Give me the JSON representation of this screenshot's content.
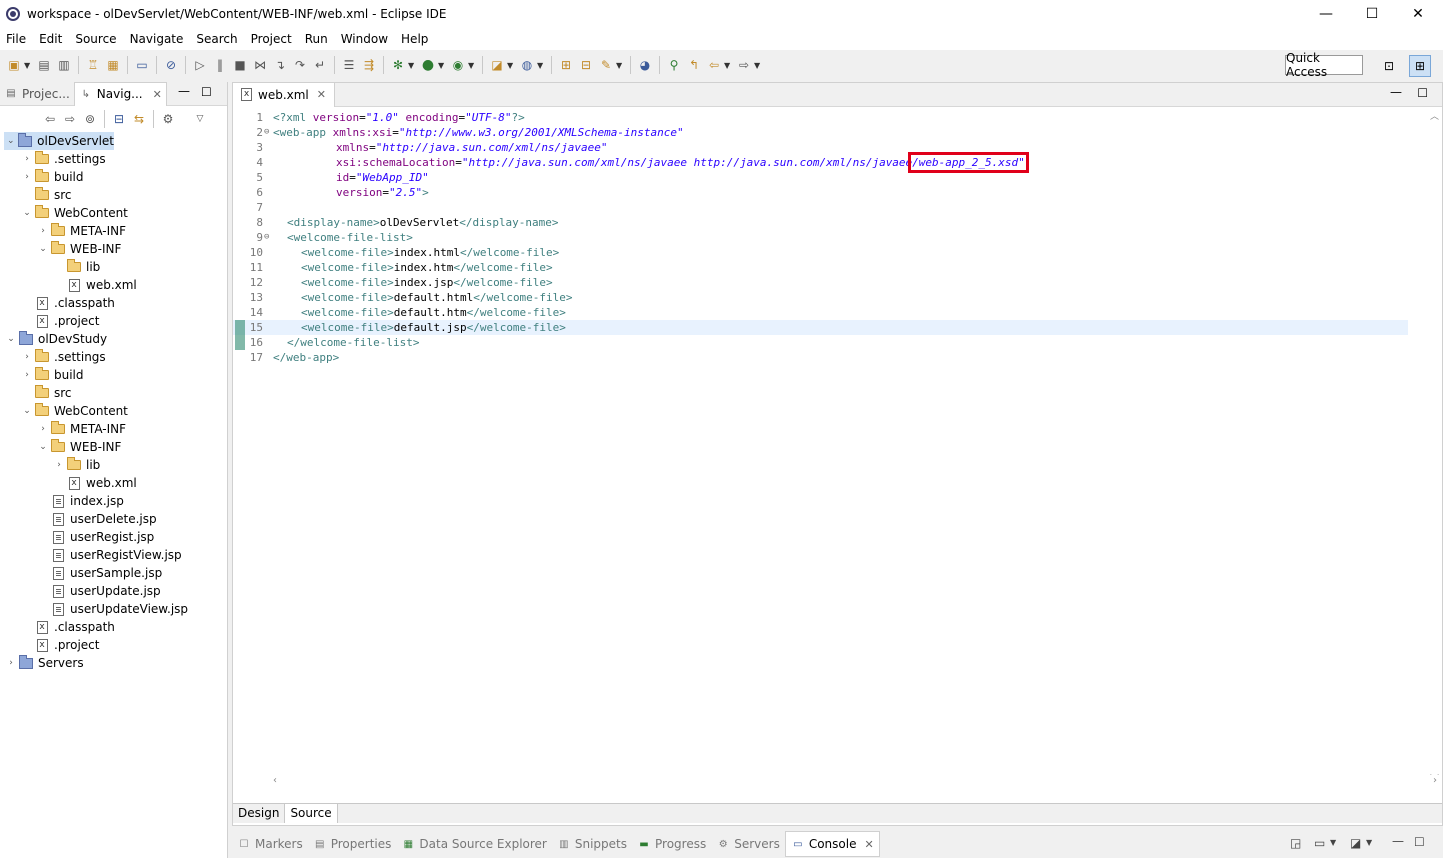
{
  "window": {
    "title": "workspace - olDevServlet/WebContent/WEB-INF/web.xml - Eclipse IDE",
    "minimize": "—",
    "maximize": "☐",
    "close": "✕"
  },
  "menu": [
    "File",
    "Edit",
    "Source",
    "Navigate",
    "Search",
    "Project",
    "Run",
    "Window",
    "Help"
  ],
  "toolbar": {
    "quick_access": "Quick Access"
  },
  "left_panel": {
    "tabs": [
      {
        "label": "Projec..."
      },
      {
        "label": "Navig..."
      }
    ],
    "tree": [
      {
        "label": "olDevServlet",
        "icon": "project-icon",
        "expanded": true,
        "selected": true
      },
      {
        "label": ".settings",
        "icon": "folder-icon"
      },
      {
        "label": "build",
        "icon": "folder-icon"
      },
      {
        "label": "src",
        "icon": "folder-icon"
      },
      {
        "label": "WebContent",
        "icon": "folder-icon"
      },
      {
        "label": "META-INF",
        "icon": "folder-icon"
      },
      {
        "label": "WEB-INF",
        "icon": "folder-icon"
      },
      {
        "label": "lib",
        "icon": "folder-icon"
      },
      {
        "label": "web.xml",
        "icon": "xml-file-icon"
      },
      {
        "label": ".classpath",
        "icon": "xml-file-icon"
      },
      {
        "label": ".project",
        "icon": "xml-file-icon"
      },
      {
        "label": "olDevStudy",
        "icon": "project-icon"
      },
      {
        "label": ".settings",
        "icon": "folder-icon"
      },
      {
        "label": "build",
        "icon": "folder-icon"
      },
      {
        "label": "src",
        "icon": "folder-icon"
      },
      {
        "label": "WebContent",
        "icon": "folder-icon"
      },
      {
        "label": "META-INF",
        "icon": "folder-icon"
      },
      {
        "label": "WEB-INF",
        "icon": "folder-icon"
      },
      {
        "label": "lib",
        "icon": "folder-icon"
      },
      {
        "label": "web.xml",
        "icon": "xml-file-icon"
      },
      {
        "label": "index.jsp",
        "icon": "jsp-file-icon"
      },
      {
        "label": "userDelete.jsp",
        "icon": "jsp-file-icon"
      },
      {
        "label": "userRegist.jsp",
        "icon": "jsp-file-icon"
      },
      {
        "label": "userRegistView.jsp",
        "icon": "jsp-file-icon"
      },
      {
        "label": "userSample.jsp",
        "icon": "jsp-file-icon"
      },
      {
        "label": "userUpdate.jsp",
        "icon": "jsp-file-icon"
      },
      {
        "label": "userUpdateView.jsp",
        "icon": "jsp-file-icon"
      },
      {
        "label": ".classpath",
        "icon": "xml-file-icon"
      },
      {
        "label": ".project",
        "icon": "xml-file-icon"
      },
      {
        "label": "Servers",
        "icon": "project-icon"
      }
    ]
  },
  "editor": {
    "tab_label": "web.xml",
    "lines": [
      "1",
      "2",
      "3",
      "4",
      "5",
      "6",
      "7",
      "8",
      "9",
      "10",
      "11",
      "12",
      "13",
      "14",
      "15",
      "16",
      "17"
    ],
    "code": {
      "l1": [
        "<?xml ",
        "version",
        "=",
        "\"1.0\"",
        " ",
        "encoding",
        "=",
        "\"UTF-8\"",
        "?>"
      ],
      "l2": [
        "<web-app ",
        "xmlns:xsi",
        "=",
        "\"http://www.w3.org/2001/XMLSchema-instance\""
      ],
      "l3": [
        "xmlns",
        "=",
        "\"http://java.sun.com/xml/ns/javaee\""
      ],
      "l4": [
        "xsi:schemaLocation",
        "=",
        "\"http://java.sun.com/xml/ns/javaee http://java.sun.com/xml/ns/javaee",
        "/web-app_2_5.xsd\""
      ],
      "l5": [
        "id",
        "=",
        "\"WebApp_ID\""
      ],
      "l6": [
        "version",
        "=",
        "\"2.5\"",
        ">"
      ],
      "l8": [
        "<display-name>",
        "olDevServlet",
        "</display-name>"
      ],
      "l9": [
        "<welcome-file-list>"
      ],
      "l10": [
        "<welcome-file>",
        "index.html",
        "</welcome-file>"
      ],
      "l11": [
        "<welcome-file>",
        "index.htm",
        "</welcome-file>"
      ],
      "l12": [
        "<welcome-file>",
        "index.jsp",
        "</welcome-file>"
      ],
      "l13": [
        "<welcome-file>",
        "default.html",
        "</welcome-file>"
      ],
      "l14": [
        "<welcome-file>",
        "default.htm",
        "</welcome-file>"
      ],
      "l15": [
        "<welcome-file>",
        "default.jsp",
        "</welcome-file>"
      ],
      "l16": [
        "</welcome-file-list>"
      ],
      "l17": [
        "</web-app>"
      ]
    },
    "design_tab": "Design",
    "source_tab": "Source"
  },
  "bottom_panel": {
    "tabs": [
      {
        "label": "Markers",
        "icon": "markers-icon"
      },
      {
        "label": "Properties",
        "icon": "properties-icon"
      },
      {
        "label": "Data Source Explorer",
        "icon": "datasource-icon"
      },
      {
        "label": "Snippets",
        "icon": "snippets-icon"
      },
      {
        "label": "Progress",
        "icon": "progress-icon"
      },
      {
        "label": "Servers",
        "icon": "servers-icon"
      },
      {
        "label": "Console",
        "icon": "console-icon"
      }
    ]
  },
  "colors": {
    "tag": "#3f7f7f",
    "attribute": "#7f007f",
    "value": "#2a00ff",
    "highlight_box": "#e0001a",
    "selection": "#cce0f5"
  }
}
